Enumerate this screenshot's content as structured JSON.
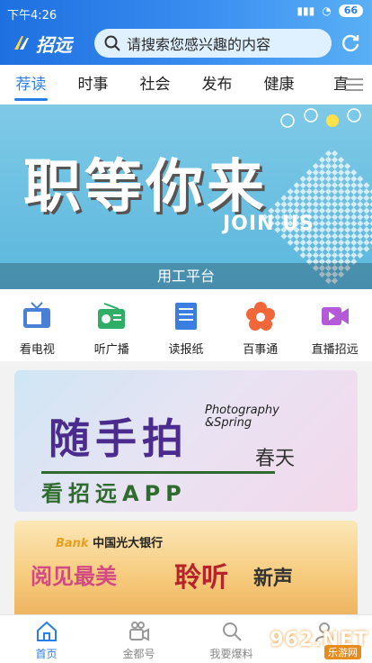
{
  "status": {
    "time": "下午4:26",
    "battery": "66"
  },
  "header": {
    "logo_text": "招远",
    "search_placeholder": "请搜索您感兴趣的内容"
  },
  "tabs": [
    {
      "label": "荐读",
      "active": true
    },
    {
      "label": "时事",
      "active": false
    },
    {
      "label": "社会",
      "active": false
    },
    {
      "label": "发布",
      "active": false
    },
    {
      "label": "健康",
      "active": false
    },
    {
      "label": "直",
      "active": false
    }
  ],
  "banner": {
    "title": "职等你来",
    "subtitle": "JOIN US",
    "caption": "用工平台"
  },
  "quick_nav": [
    {
      "label": "看电视",
      "icon": "tv-icon",
      "color": "#4a7fd6"
    },
    {
      "label": "听广播",
      "icon": "radio-icon",
      "color": "#2fae66"
    },
    {
      "label": "读报纸",
      "icon": "newspaper-icon",
      "color": "#3a7fe0"
    },
    {
      "label": "百事通",
      "icon": "flower-icon",
      "color": "#f0683a"
    },
    {
      "label": "直播招远",
      "icon": "video-icon",
      "color": "#b45ad9"
    }
  ],
  "cards": {
    "card1": {
      "headline": "随手拍",
      "photo_text_1": "Photography",
      "photo_text_2": "&Spring",
      "spring": "春天",
      "sub": "看招远APP"
    },
    "card2": {
      "bank_prefix": "Bank",
      "bank_name": "中国光大银行",
      "t1": "阅见最美",
      "t2": "聆听",
      "t3": "新声"
    }
  },
  "bottom_nav": [
    {
      "label": "首页",
      "active": true,
      "icon": "home-icon"
    },
    {
      "label": "金都号",
      "active": false,
      "icon": "camera-icon"
    },
    {
      "label": "我要爆料",
      "active": false,
      "icon": "report-icon"
    },
    {
      "label": "",
      "active": false,
      "icon": "user-icon"
    }
  ],
  "watermark": {
    "main": "962.NET",
    "sub": "乐游网"
  },
  "colors": {
    "accent": "#2a7ee8",
    "header_start": "#1e6fe0",
    "header_end": "#5ab0f5"
  }
}
